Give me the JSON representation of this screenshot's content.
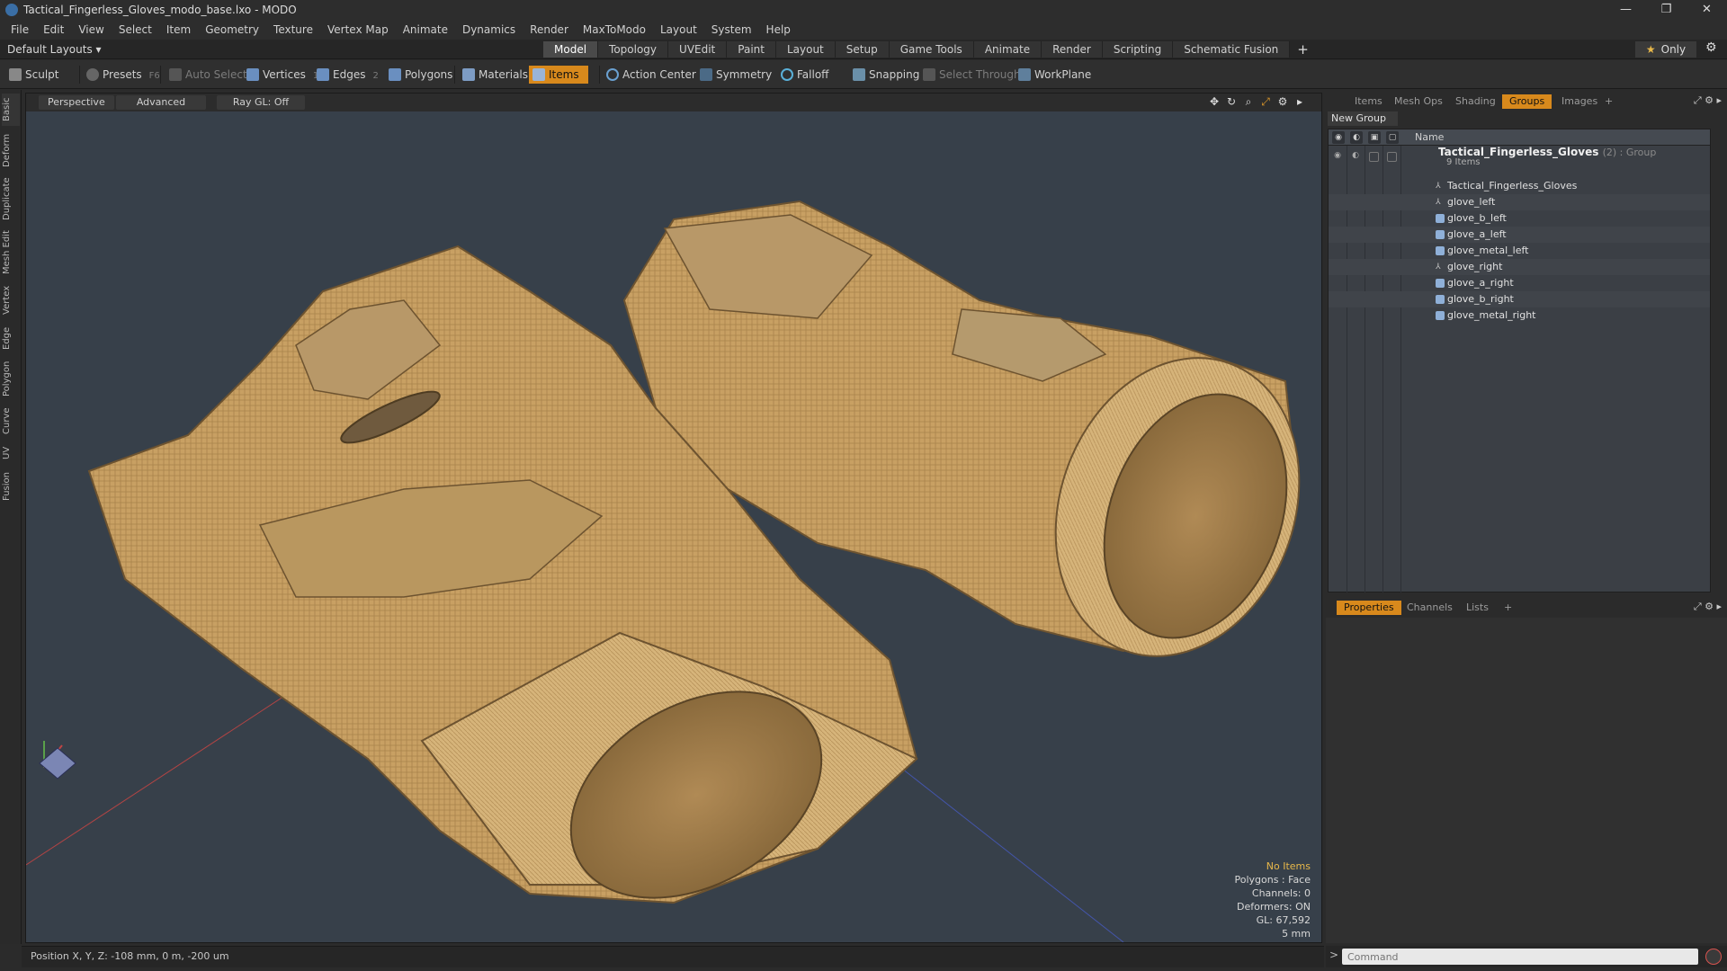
{
  "window": {
    "title": "Tactical_Fingerless_Gloves_modo_base.lxo - MODO",
    "controls": [
      "—",
      "❐",
      "✕"
    ]
  },
  "menu": [
    "File",
    "Edit",
    "View",
    "Select",
    "Item",
    "Geometry",
    "Texture",
    "Vertex Map",
    "Animate",
    "Dynamics",
    "Render",
    "MaxToModo",
    "Layout",
    "System",
    "Help"
  ],
  "layout": {
    "dropdown": "Default Layouts ▾",
    "tabs": [
      "Model",
      "Topology",
      "UVEdit",
      "Paint",
      "Layout",
      "Setup",
      "Game Tools",
      "Animate",
      "Render",
      "Scripting",
      "Schematic Fusion"
    ],
    "active_tab": "Model",
    "add_tab": "+",
    "only_label": "Only"
  },
  "toolbar": {
    "sculpt": "Sculpt",
    "presets": "Presets",
    "presets_key": "F6",
    "auto_select": "Auto Select",
    "vertices": "Vertices",
    "vertices_count": "1",
    "edges": "Edges",
    "edges_count": "2",
    "polygons": "Polygons",
    "materials": "Materials",
    "items": "Items",
    "action_center": "Action Center",
    "symmetry": "Symmetry",
    "falloff": "Falloff",
    "snapping": "Snapping",
    "select_through": "Select Through",
    "workplane": "WorkPlane"
  },
  "left_tabs": [
    "Basic",
    "Deform",
    "Duplicate",
    "Mesh Edit",
    "Vertex",
    "Edge",
    "Polygon",
    "Curve",
    "UV",
    "Fusion"
  ],
  "viewport": {
    "view": "Perspective",
    "shading": "Advanced",
    "raygl": "Ray GL: Off",
    "stats": {
      "selection": "No Items",
      "polygons": "Polygons : Face",
      "channels": "Channels: 0",
      "deformers": "Deformers: ON",
      "gl": "GL: 67,592",
      "scale": "5 mm"
    }
  },
  "status": {
    "position": "Position X, Y, Z:  -108 mm, 0 m, -200 um"
  },
  "right_panel": {
    "tabs": [
      "Items",
      "Mesh Ops",
      "Shading",
      "Groups",
      "Images",
      "+"
    ],
    "active_tab": "Groups",
    "new_group": "New Group",
    "column_name": "Name",
    "group": {
      "name": "Tactical_Fingerless_Gloves",
      "count": "(2) : Group",
      "sub": "9 Items"
    },
    "items": [
      {
        "name": "Tactical_Fingerless_Gloves",
        "icon": "locator-icon"
      },
      {
        "name": "glove_left",
        "icon": "locator-icon"
      },
      {
        "name": "glove_b_left",
        "icon": "mesh-icon"
      },
      {
        "name": "glove_a_left",
        "icon": "mesh-icon"
      },
      {
        "name": "glove_metal_left",
        "icon": "mesh-icon"
      },
      {
        "name": "glove_right",
        "icon": "locator-icon"
      },
      {
        "name": "glove_a_right",
        "icon": "mesh-icon"
      },
      {
        "name": "glove_b_right",
        "icon": "mesh-icon"
      },
      {
        "name": "glove_metal_right",
        "icon": "mesh-icon"
      }
    ]
  },
  "props_panel": {
    "tabs": [
      "Properties",
      "Channels",
      "Lists",
      "+"
    ],
    "active_tab": "Properties"
  },
  "command": {
    "placeholder": "Command",
    "prompt": ">"
  },
  "colors": {
    "accent": "#d8891c",
    "viewport_bg": "#37404a",
    "glove_tan": "#c9a060"
  }
}
